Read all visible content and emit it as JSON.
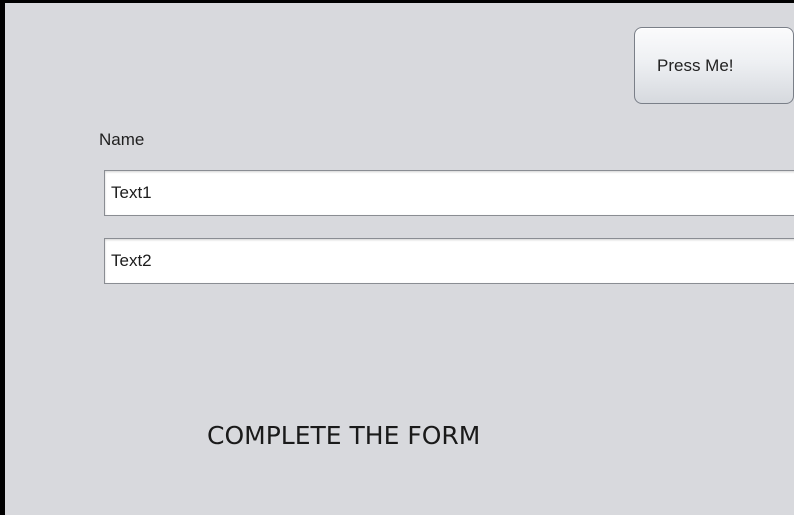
{
  "form": {
    "press_button_label": "Press Me!",
    "name_label": "Name",
    "field1_value": "Text1",
    "field2_value": "Text2",
    "message": "COMPLETE THE FORM"
  },
  "colors": {
    "background": "#d8d9dd",
    "border": "#000000",
    "field_background": "#ffffff"
  }
}
